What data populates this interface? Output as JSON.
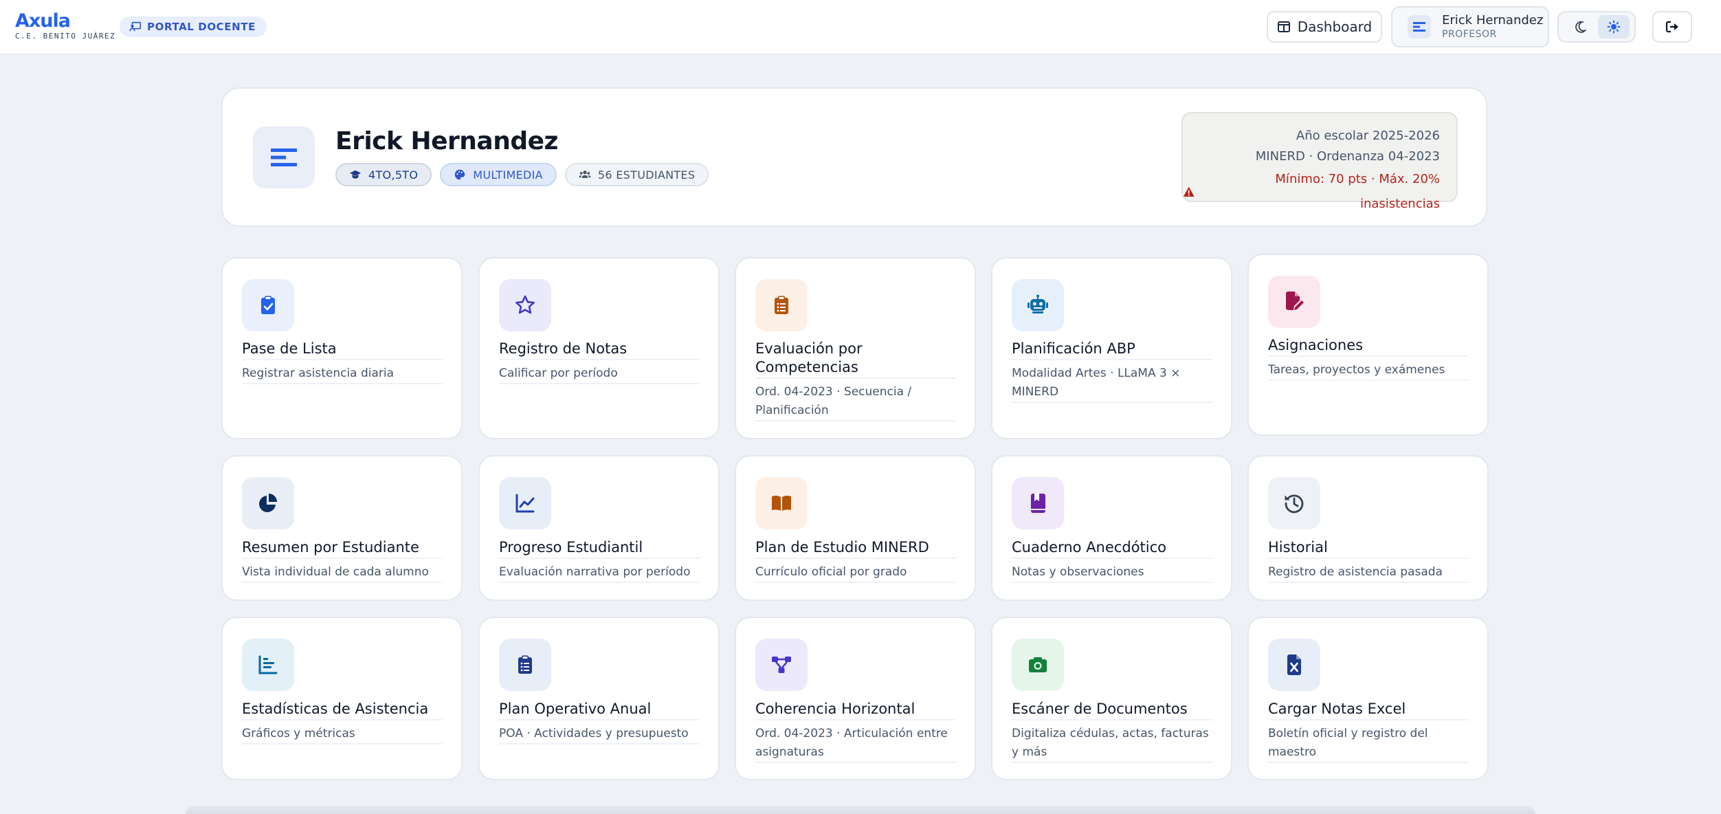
{
  "brand": {
    "name": "Axula",
    "school": "C.E. BENITO JUÁREZ",
    "portal": "PORTAL DOCENTE"
  },
  "header": {
    "dashboard_label": "Dashboard",
    "user_name": "Erick Hernandez",
    "user_role": "PROFESOR"
  },
  "profile": {
    "name": "Erick Hernandez",
    "grade": "4TO,5TO",
    "area": "MULTIMEDIA",
    "students": "56 ESTUDIANTES",
    "school_year": "Año escolar 2025-2026",
    "regulation": "MINERD · Ordenanza 04-2023",
    "requirement": "Mínimo: 70 pts · Máx. 20% inasistencias"
  },
  "tiles": [
    {
      "title": "Pase de Lista",
      "subtitle": "Registrar asistencia diaria",
      "icon": "clipboard-check-icon",
      "bg": "#eaf0fb",
      "fg": "#2563eb"
    },
    {
      "title": "Registro de Notas",
      "subtitle": "Calificar por período",
      "icon": "star-icon",
      "bg": "#ebeafb",
      "fg": "#4338ca"
    },
    {
      "title": "Evaluación por Competencias",
      "subtitle": "Ord. 04-2023 · Secuencia / Planificación",
      "icon": "clipboard-list-icon",
      "bg": "#fcf0e6",
      "fg": "#b45309"
    },
    {
      "title": "Planificación ABP",
      "subtitle": "Modalidad Artes · LLaMA 3 × MINERD",
      "icon": "robot-icon",
      "bg": "#e6f0fa",
      "fg": "#0e6fa8"
    },
    {
      "title": "Asignaciones",
      "subtitle": "Tareas, proyectos y exámenes",
      "icon": "file-pen-icon",
      "bg": "#fbe8ef",
      "fg": "#9d174d"
    },
    {
      "title": "Resumen por Estudiante",
      "subtitle": "Vista individual de cada alumno",
      "icon": "pie-chart-icon",
      "bg": "#e9eef6",
      "fg": "#0f2d5c"
    },
    {
      "title": "Progreso Estudiantil",
      "subtitle": "Evaluación narrativa por período",
      "icon": "line-chart-icon",
      "bg": "#e8eef8",
      "fg": "#1e40af"
    },
    {
      "title": "Plan de Estudio MINERD",
      "subtitle": "Currículo oficial por grado",
      "icon": "book-open-icon",
      "bg": "#fcf0e6",
      "fg": "#b45309"
    },
    {
      "title": "Cuaderno Anecdótico",
      "subtitle": "Notas y observaciones",
      "icon": "bookmark-book-icon",
      "bg": "#f0e9f9",
      "fg": "#6b21a8"
    },
    {
      "title": "Historial",
      "subtitle": "Registro de asistencia pasada",
      "icon": "history-icon",
      "bg": "#eef1f5",
      "fg": "#334155"
    },
    {
      "title": "Estadísticas de Asistencia",
      "subtitle": "Gráficos y métricas",
      "icon": "bar-chart-icon",
      "bg": "#e4f0f8",
      "fg": "#0369a1"
    },
    {
      "title": "Plan Operativo Anual",
      "subtitle": "POA · Actividades y presupuesto",
      "icon": "clipboard-list-icon",
      "bg": "#e8eef8",
      "fg": "#1e3a8a"
    },
    {
      "title": "Coherencia Horizontal",
      "subtitle": "Ord. 04-2023 · Articulación entre asignaturas",
      "icon": "diagram-icon",
      "bg": "#ebe9fa",
      "fg": "#4338ca"
    },
    {
      "title": "Escáner de Documentos",
      "subtitle": "Digitaliza cédulas, actas, facturas y más",
      "icon": "camera-icon",
      "bg": "#e6f5e9",
      "fg": "#15803d"
    },
    {
      "title": "Cargar Notas Excel",
      "subtitle": "Boletín oficial y registro del maestro",
      "icon": "file-excel-icon",
      "bg": "#e7eef8",
      "fg": "#1e3a8a"
    }
  ]
}
